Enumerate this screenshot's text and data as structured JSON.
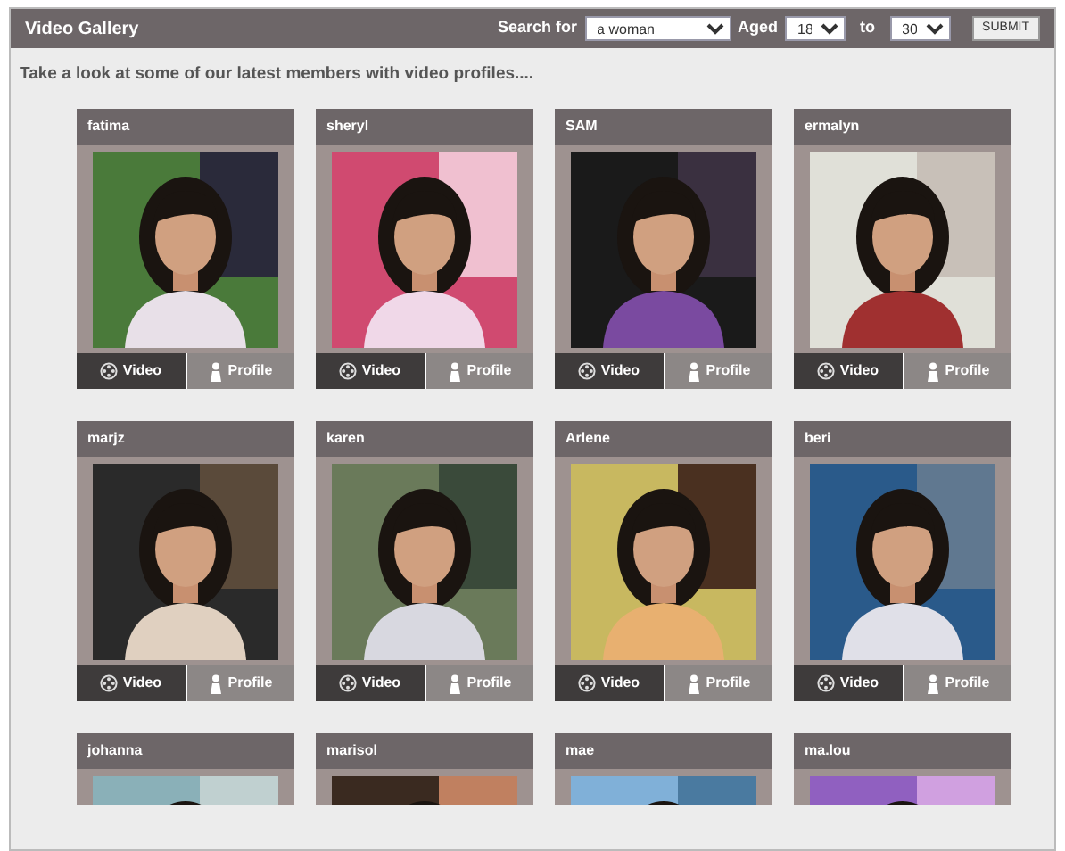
{
  "header": {
    "title": "Video Gallery",
    "search_label": "Search for",
    "seeking": "a woman",
    "aged_label": "Aged",
    "age_from": "18",
    "to_label": "to",
    "age_to": "30",
    "submit": "SUBMIT"
  },
  "intro": "Take a look at some of our latest members with video profiles....",
  "members": [
    {
      "name": "fatima",
      "buttons": [
        "Video",
        "Profile"
      ]
    },
    {
      "name": "sheryl",
      "buttons": [
        "Video",
        "Profile"
      ]
    },
    {
      "name": "SAM",
      "buttons": [
        "Video",
        "Profile"
      ]
    },
    {
      "name": "ermalyn",
      "buttons": [
        "Video",
        "Profile"
      ]
    },
    {
      "name": "marjz",
      "buttons": [
        "Video",
        "Profile"
      ]
    },
    {
      "name": "karen",
      "buttons": [
        "Video",
        "Profile"
      ]
    },
    {
      "name": "Arlene",
      "buttons": [
        "Video",
        "Profile"
      ]
    },
    {
      "name": "beri",
      "buttons": [
        "Video",
        "Profile"
      ]
    },
    {
      "name": "johanna"
    },
    {
      "name": "marisol"
    },
    {
      "name": "mae"
    },
    {
      "name": "ma.lou"
    }
  ]
}
